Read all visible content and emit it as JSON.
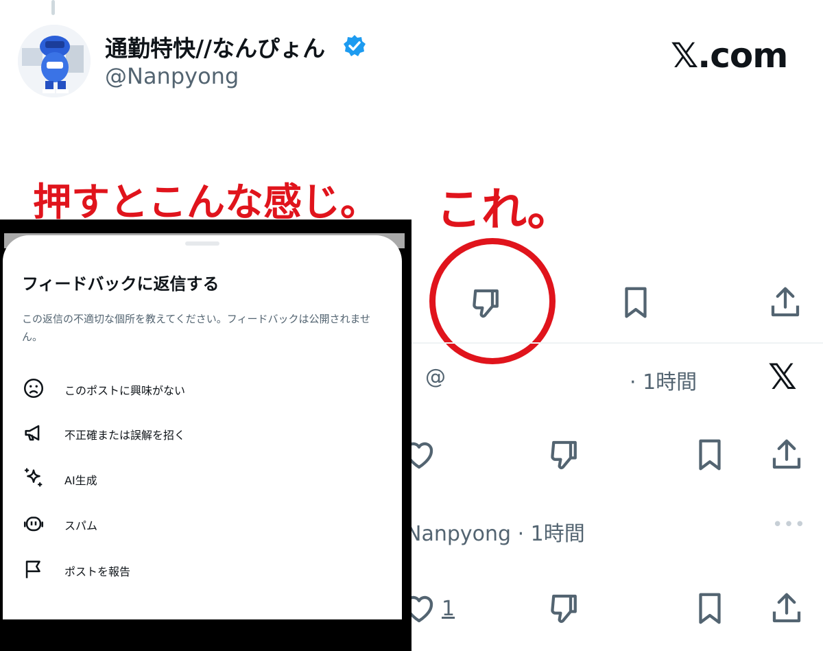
{
  "header": {
    "display_name": "通勤特快//なんぴょん",
    "handle": "@Nanpyong",
    "site": "𝕏.com",
    "verified_color": "#1d9bf0"
  },
  "annotations": {
    "left_caption": "押すとこんな感じ。",
    "right_caption": "これ。",
    "color": "#e0141c"
  },
  "feedback_sheet": {
    "title": "フィードバックに返信する",
    "description": "この返信の不適切な個所を教えてください。フィードバックは公開されません。",
    "options": [
      {
        "label": "このポストに興味がない",
        "icon": "sad-face-icon"
      },
      {
        "label": "不正確または誤解を招く",
        "icon": "megaphone-icon"
      },
      {
        "label": "AI生成",
        "icon": "sparkle-icon"
      },
      {
        "label": "スパム",
        "icon": "bot-icon"
      },
      {
        "label": "ポストを報告",
        "icon": "flag-icon"
      }
    ]
  },
  "replies": [
    {
      "handle_prefix": "@",
      "meta": "· 1時間",
      "logo": "𝕏"
    },
    {
      "handle_fragment": "Nanpyong · 1時間",
      "more": "•••",
      "likes": "1"
    }
  ]
}
